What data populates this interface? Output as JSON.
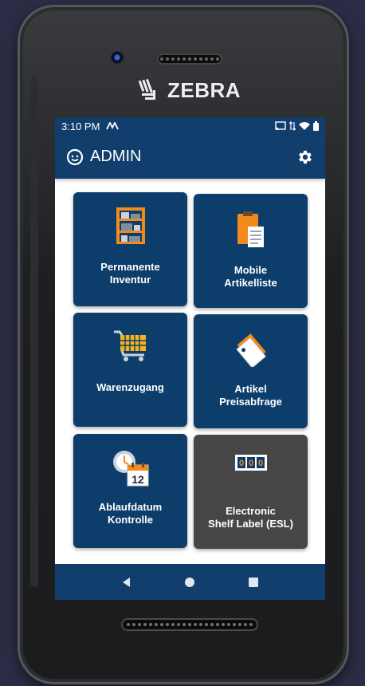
{
  "device": {
    "brand": "ZEBRA"
  },
  "status_bar": {
    "time": "3:10 PM"
  },
  "app_bar": {
    "title": "ADMIN"
  },
  "tiles": [
    {
      "label": "Permanente\nInventur",
      "icon": "shelf-icon"
    },
    {
      "label": "Mobile\nArtikelliste",
      "icon": "clipboard-icon"
    },
    {
      "label": "Warenzugang",
      "icon": "shopping-cart-icon"
    },
    {
      "label": "Artikel\nPreisabfrage",
      "icon": "price-tag-icon"
    },
    {
      "label": "Ablaufdatum\nKontrolle",
      "icon": "clock-calendar-icon",
      "calendar_day": "12"
    },
    {
      "label": "Electronic\nShelf Label (ESL)",
      "icon": "esl-display-icon",
      "display_digits": "000"
    }
  ],
  "colors": {
    "primary": "#123e6d",
    "tile": "#0c3d6b",
    "tile_disabled": "#464646",
    "accent": "#f48a1e"
  }
}
